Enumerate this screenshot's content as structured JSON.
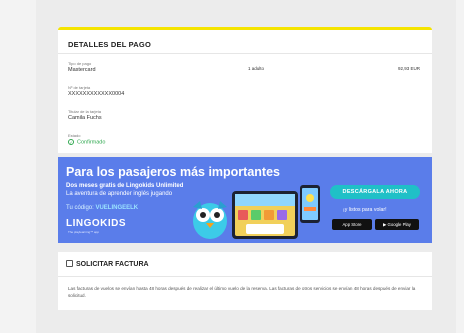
{
  "payment": {
    "title": "DETALLES DEL PAGO",
    "payment_type_label": "Tipo de pago",
    "payment_type_value": "Mastercard",
    "card_number_label": "Nº de tarjeta",
    "card_number_value": "XXXXXXXXXXXX0004",
    "cardholder_label": "Titular de la tarjeta",
    "cardholder_value": "Camila Fuchs",
    "status_label": "Estado",
    "status_value": "Confirmado",
    "passengers": "1 adulto",
    "price": "92,93 EUR"
  },
  "banner": {
    "title": "Para los pasajeros más importantes",
    "subtitle_line1": "Dos meses gratis de Lingokids Unlimited",
    "subtitle_line2": "La aventura de aprender inglés jugando",
    "code_label": "Tu código:",
    "code_value": "VUELINGEELK",
    "brand": "LINGOKIDS",
    "brand_tagline": "The playlearning™ app",
    "cta": "DESCÁRGALA AHORA",
    "ready_text": "¡y listos para volar!",
    "app_store": "App Store",
    "google_play": "Google Play",
    "colors": {
      "background": "#5a7dea",
      "cta": "#1fc0c7"
    }
  },
  "invoice": {
    "label": "SOLICITAR FACTURA",
    "note": "Las facturas de vuelos se envían hasta 48 horas después de realizar el último vuelo de la reserva. Las facturas de otros servicios se envían 48 horas después de enviar la solicitud."
  }
}
